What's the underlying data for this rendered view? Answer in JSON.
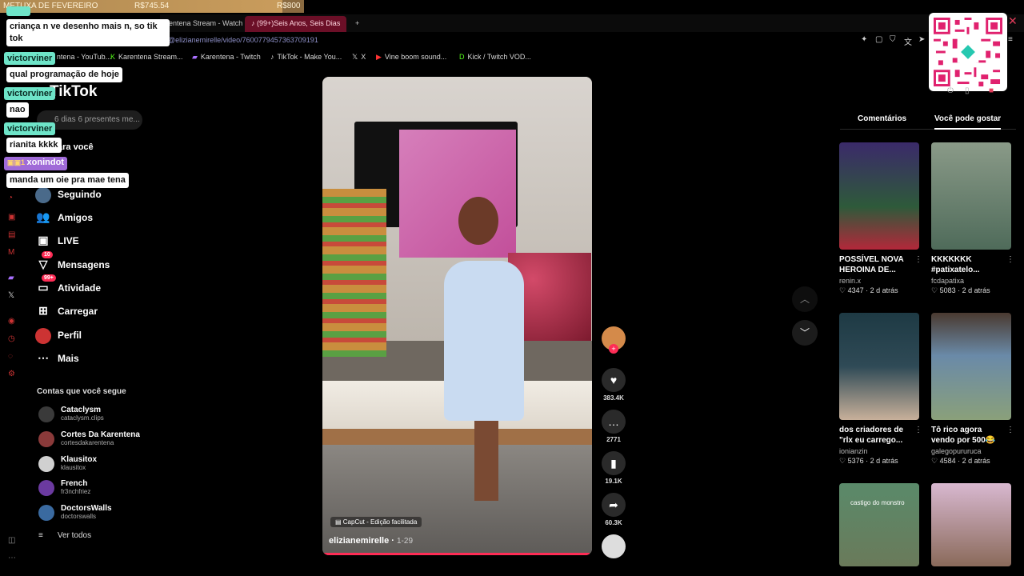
{
  "goal": {
    "name": "METUXA DE FEVEREIRO",
    "current": "R$745.54",
    "target": "R$800",
    "progress": 0.93
  },
  "tabs": [
    {
      "label": "rentena Stream - Watch"
    },
    {
      "label": "(99+)Seis Anos, Seis Dias"
    }
  ],
  "new_tab": "+",
  "url": "@elizianemirelle/video/7600779457363709191",
  "bookmarks": [
    {
      "label": "ntena - YouTub...",
      "icon": "youtube-icon"
    },
    {
      "label": "Karentena Stream...",
      "icon": "kick-icon"
    },
    {
      "label": "Karentena - Twitch",
      "icon": "twitch-icon"
    },
    {
      "label": "TikTok - Make You...",
      "icon": "tiktok-icon"
    },
    {
      "label": "X",
      "icon": "x-icon"
    },
    {
      "label": "Vine boom sound...",
      "icon": "youtube-icon"
    },
    {
      "label": "Kick / Twitch VOD...",
      "icon": "kick-icon"
    }
  ],
  "chat": [
    {
      "user": "",
      "text": "criança n ve desenho mais n, so tik tok"
    },
    {
      "user": "victorviner",
      "text": "qual programação de hoje"
    },
    {
      "user": "victorviner",
      "text": "nao"
    },
    {
      "user": "victorviner",
      "text": "rianita kkkk"
    },
    {
      "user": "xonindot",
      "text": "manda um oie pra mae tena"
    }
  ],
  "sidebar": {
    "logo": "TikTok",
    "search_placeholder": "6 dias 6 presentes me...",
    "for_you": "ara você",
    "items": [
      {
        "label": "Seguindo",
        "icon": "following-avatar-icon"
      },
      {
        "label": "Amigos",
        "icon": "friends-icon"
      },
      {
        "label": "LIVE",
        "icon": "live-icon"
      },
      {
        "label": "Mensagens",
        "icon": "messages-icon",
        "badge": "10"
      },
      {
        "label": "Atividade",
        "icon": "activity-icon",
        "badge": "99+"
      },
      {
        "label": "Carregar",
        "icon": "upload-icon"
      },
      {
        "label": "Perfil",
        "icon": "profile-icon"
      },
      {
        "label": "Mais",
        "icon": "more-icon"
      }
    ],
    "following_header": "Contas que você segue",
    "accounts": [
      {
        "name": "Cataclysm",
        "handle": "cataclysm.clips",
        "color": "#3a3a3a"
      },
      {
        "name": "Cortes Da Karentena",
        "handle": "cortesdakarentena",
        "color": "#8a3a3a"
      },
      {
        "name": "Klausitox",
        "handle": "klausitox",
        "color": "#d0d0d0"
      },
      {
        "name": "French",
        "handle": "fr3nchfriez",
        "color": "#6b3aa0"
      },
      {
        "name": "DoctorsWalls",
        "handle": "doctorswalls",
        "color": "#3a6aa0"
      }
    ],
    "see_all": "Ver todos"
  },
  "video": {
    "caption_tag": "CapCut - Edição facilitada",
    "author": "elizianemirelle",
    "date": "1-29",
    "progress": 0.99
  },
  "actions": [
    {
      "name": "like-button",
      "icon": "♥",
      "count": "383.4K"
    },
    {
      "name": "comment-button",
      "icon": "…",
      "count": "2771"
    },
    {
      "name": "save-button",
      "icon": "▮",
      "count": "19.1K"
    },
    {
      "name": "share-button",
      "icon": "➦",
      "count": "60.3K"
    }
  ],
  "right": {
    "tabs": [
      "Comentários",
      "Você pode gostar"
    ],
    "cards": [
      {
        "title": "POSSÍVEL NOVA HEROINA DE...",
        "author": "renin.x",
        "likes": "4347",
        "time": "2 d atrás",
        "color": "#2e5a3a"
      },
      {
        "title": "KKKKKKK #patixatelo...",
        "author": "fcdapatixa",
        "likes": "5083",
        "time": "2 d atrás",
        "color": "#4f6b5a"
      },
      {
        "title": "dos criadores de \"rlx eu carrego...",
        "author": "ionianzin",
        "likes": "5376",
        "time": "2 d atrás",
        "color": "#2f4a56"
      },
      {
        "title": "Tô rico agora vendo por 500😂",
        "author": "galegopururuca",
        "likes": "4584",
        "time": "2 d atrás",
        "color": "#6a8aa8"
      },
      {
        "title": "",
        "author": "",
        "likes": "",
        "time": "",
        "color": "#6a7a5a"
      },
      {
        "title": "",
        "author": "",
        "likes": "",
        "time": "",
        "color": "#b0a0b8"
      }
    ],
    "card5_overlay": "castigo do monstro"
  }
}
